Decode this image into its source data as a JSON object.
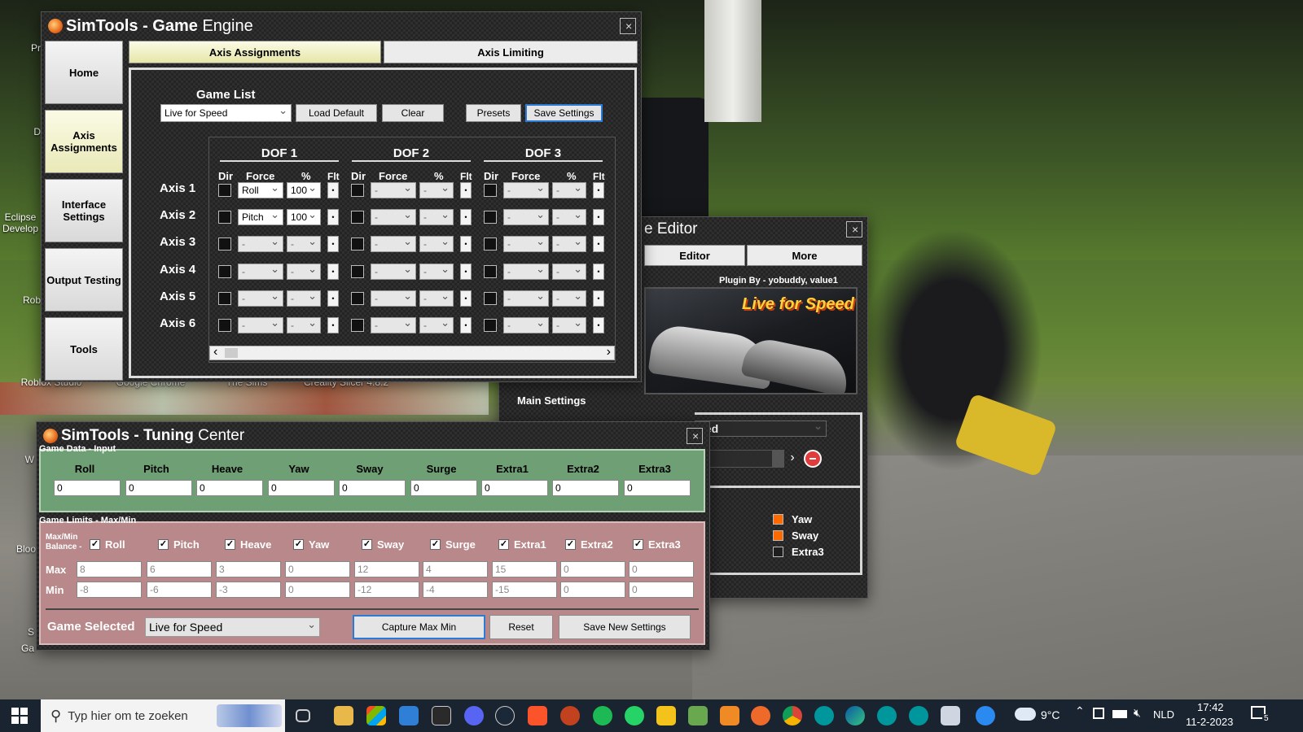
{
  "desktop": {
    "icons": [
      {
        "label": "Pr"
      },
      {
        "label": "D"
      },
      {
        "label": "Eclipse Develop"
      },
      {
        "label": "Rob"
      },
      {
        "label": "Roblox Studio"
      },
      {
        "label": "Google Chrome"
      },
      {
        "label": "The Sims"
      },
      {
        "label": "Creality Slicer 4.8.2"
      },
      {
        "label": "W"
      },
      {
        "label": "Bloo"
      },
      {
        "label": "S"
      },
      {
        "label": "Ga"
      }
    ]
  },
  "game_engine": {
    "title_bold": "SimTools - Game",
    "title_rest": " Engine",
    "close": "×",
    "side_nav": [
      "Home",
      "Axis Assignments",
      "Interface Settings",
      "Output Testing",
      "Tools"
    ],
    "tabs": [
      "Axis Assignments",
      "Axis Limiting"
    ],
    "game_list_label": "Game List",
    "game_select": "Live for Speed",
    "buttons": {
      "load_default": "Load Default",
      "clear": "Clear",
      "presets": "Presets",
      "save_settings": "Save Settings"
    },
    "dof_headers": [
      "DOF 1",
      "DOF 2",
      "DOF 3"
    ],
    "col_headers": [
      "Dir",
      "Force",
      "%",
      "Flt"
    ],
    "axes": [
      {
        "label": "Axis 1",
        "dof1_force": "Roll",
        "dof1_pct": "100"
      },
      {
        "label": "Axis 2",
        "dof1_force": "Pitch",
        "dof1_pct": "100"
      },
      {
        "label": "Axis 3",
        "dof1_force": "-",
        "dof1_pct": "-"
      },
      {
        "label": "Axis 4",
        "dof1_force": "-",
        "dof1_pct": "-"
      },
      {
        "label": "Axis 5",
        "dof1_force": "-",
        "dof1_pct": "-"
      },
      {
        "label": "Axis 6",
        "dof1_force": "-",
        "dof1_pct": "-"
      }
    ],
    "empty_value": "-",
    "flt_glyph": "•",
    "scroll_left": "‹",
    "scroll_right": "›"
  },
  "editor": {
    "title": "e Editor",
    "close": "×",
    "tabs": [
      "Editor",
      "More"
    ],
    "plugin_credit": "Plugin By - yobuddy, value1",
    "logo_text": "Live for Speed",
    "main_settings": "Main Settings",
    "game_select_partial": "eed",
    "arrow": "›",
    "legend": [
      {
        "label": "Yaw",
        "color": "#ff6a00"
      },
      {
        "label": "Sway",
        "color": "#ff6a00"
      },
      {
        "label": "Extra3",
        "color": "#1e1e1e"
      }
    ]
  },
  "tuning_center": {
    "title_bold": "SimTools - Tuning",
    "title_rest": " Center",
    "close": "×",
    "input_section": "Game Data - Input",
    "limits_section": "Game Limits - Max/Min",
    "channels": [
      "Roll",
      "Pitch",
      "Heave",
      "Yaw",
      "Sway",
      "Surge",
      "Extra1",
      "Extra2",
      "Extra3"
    ],
    "input_values": [
      "0",
      "0",
      "0",
      "0",
      "0",
      "0",
      "0",
      "0",
      "0"
    ],
    "balance_label_1": "Max/Min",
    "balance_label_2": "Balance -",
    "check_mark": "✓",
    "max_label": "Max",
    "min_label": "Min",
    "max_values": [
      "8",
      "6",
      "3",
      "0",
      "12",
      "4",
      "15",
      "0",
      "0"
    ],
    "min_values": [
      "-8",
      "-6",
      "-3",
      "0",
      "-12",
      "-4",
      "-15",
      "0",
      "0"
    ],
    "game_selected_label": "Game Selected",
    "game_selected_value": "Live for Speed",
    "buttons": {
      "capture": "Capture Max Min",
      "reset": "Reset",
      "save_new": "Save New Settings"
    }
  },
  "taskbar": {
    "search_placeholder": "Typ hier om te zoeken",
    "weather": "9°C",
    "language": "NLD",
    "time": "17:42",
    "date": "11-2-2023",
    "notifications": "5"
  }
}
